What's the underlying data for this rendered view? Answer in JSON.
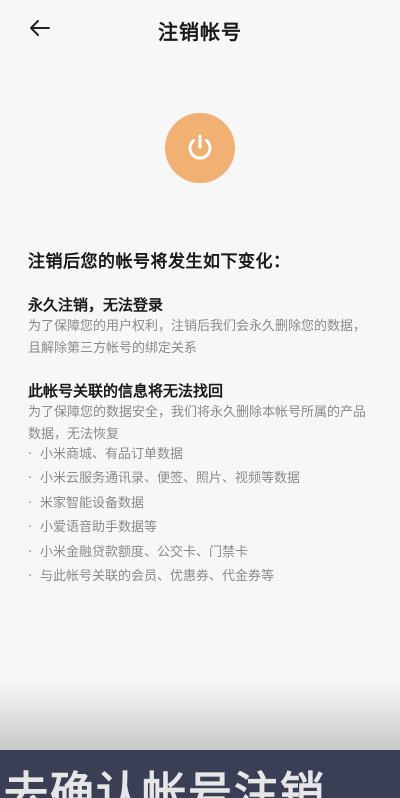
{
  "header": {
    "title": "注销帐号",
    "back_icon": "arrow-left-icon"
  },
  "hero": {
    "icon": "power-icon",
    "color": "#f1b173"
  },
  "headline": "注销后您的帐号将发生如下变化：",
  "section1": {
    "title": "永久注销，无法登录",
    "desc": "为了保障您的用户权利，注销后我们会永久删除您的数据，且解除第三方帐号的绑定关系"
  },
  "section2": {
    "title": "此帐号关联的信息将无法找回",
    "desc": "为了保障您的数据安全，我们将永久删除本帐号所属的产品数据，无法恢复",
    "items": [
      "小米商城、有品订单数据",
      "小米云服务通讯录、便签、照片、视频等数据",
      "米家智能设备数据",
      "小爱语音助手数据等",
      "小米金融贷款额度、公交卡、门禁卡",
      "与此帐号关联的会员、优惠券、代金券等"
    ]
  },
  "bottom": {
    "label": "去确认帐号注销"
  }
}
